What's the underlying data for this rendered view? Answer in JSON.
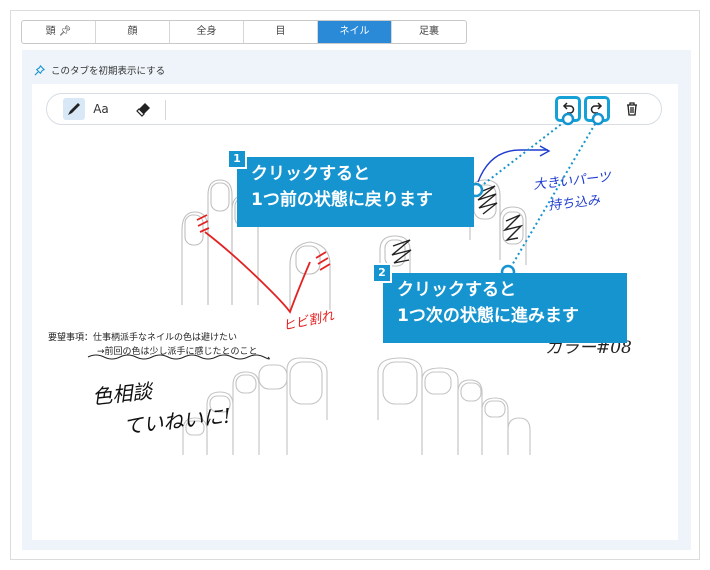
{
  "tabs": [
    {
      "label": "頭",
      "pinned": true
    },
    {
      "label": "顔"
    },
    {
      "label": "全身"
    },
    {
      "label": "目"
    },
    {
      "label": "ネイル",
      "active": true
    },
    {
      "label": "足裏"
    }
  ],
  "pin_default_label": "このタブを初期表示にする",
  "toolbar": {
    "text_tool_label": "Aa",
    "tools": [
      "pen-tool",
      "text-tool",
      "eraser-tool",
      "undo",
      "redo",
      "delete"
    ]
  },
  "callouts": [
    {
      "number": "1",
      "line1": "クリックすると",
      "line2": "1つ前の状態に戻ります"
    },
    {
      "number": "2",
      "line1": "クリックすると",
      "line2": "1つ次の状態に進みます"
    }
  ],
  "memo": {
    "line1": "要望事項：仕事柄派手なネイルの色は避けたい",
    "line2": "→前回の色は少し派手に感じたとのこと"
  },
  "handwriting": {
    "crack": "ヒビ割れ",
    "consult1": "色相談",
    "consult2": "ていねいに!",
    "parts1": "大きいパーツ",
    "parts2": "持ち込み",
    "partial": "カラー#08"
  },
  "colors": {
    "accent": "#1594cf",
    "tab_active": "#2b8ad8",
    "ink_red": "#e32222",
    "ink_blue": "#1f3ccf"
  }
}
